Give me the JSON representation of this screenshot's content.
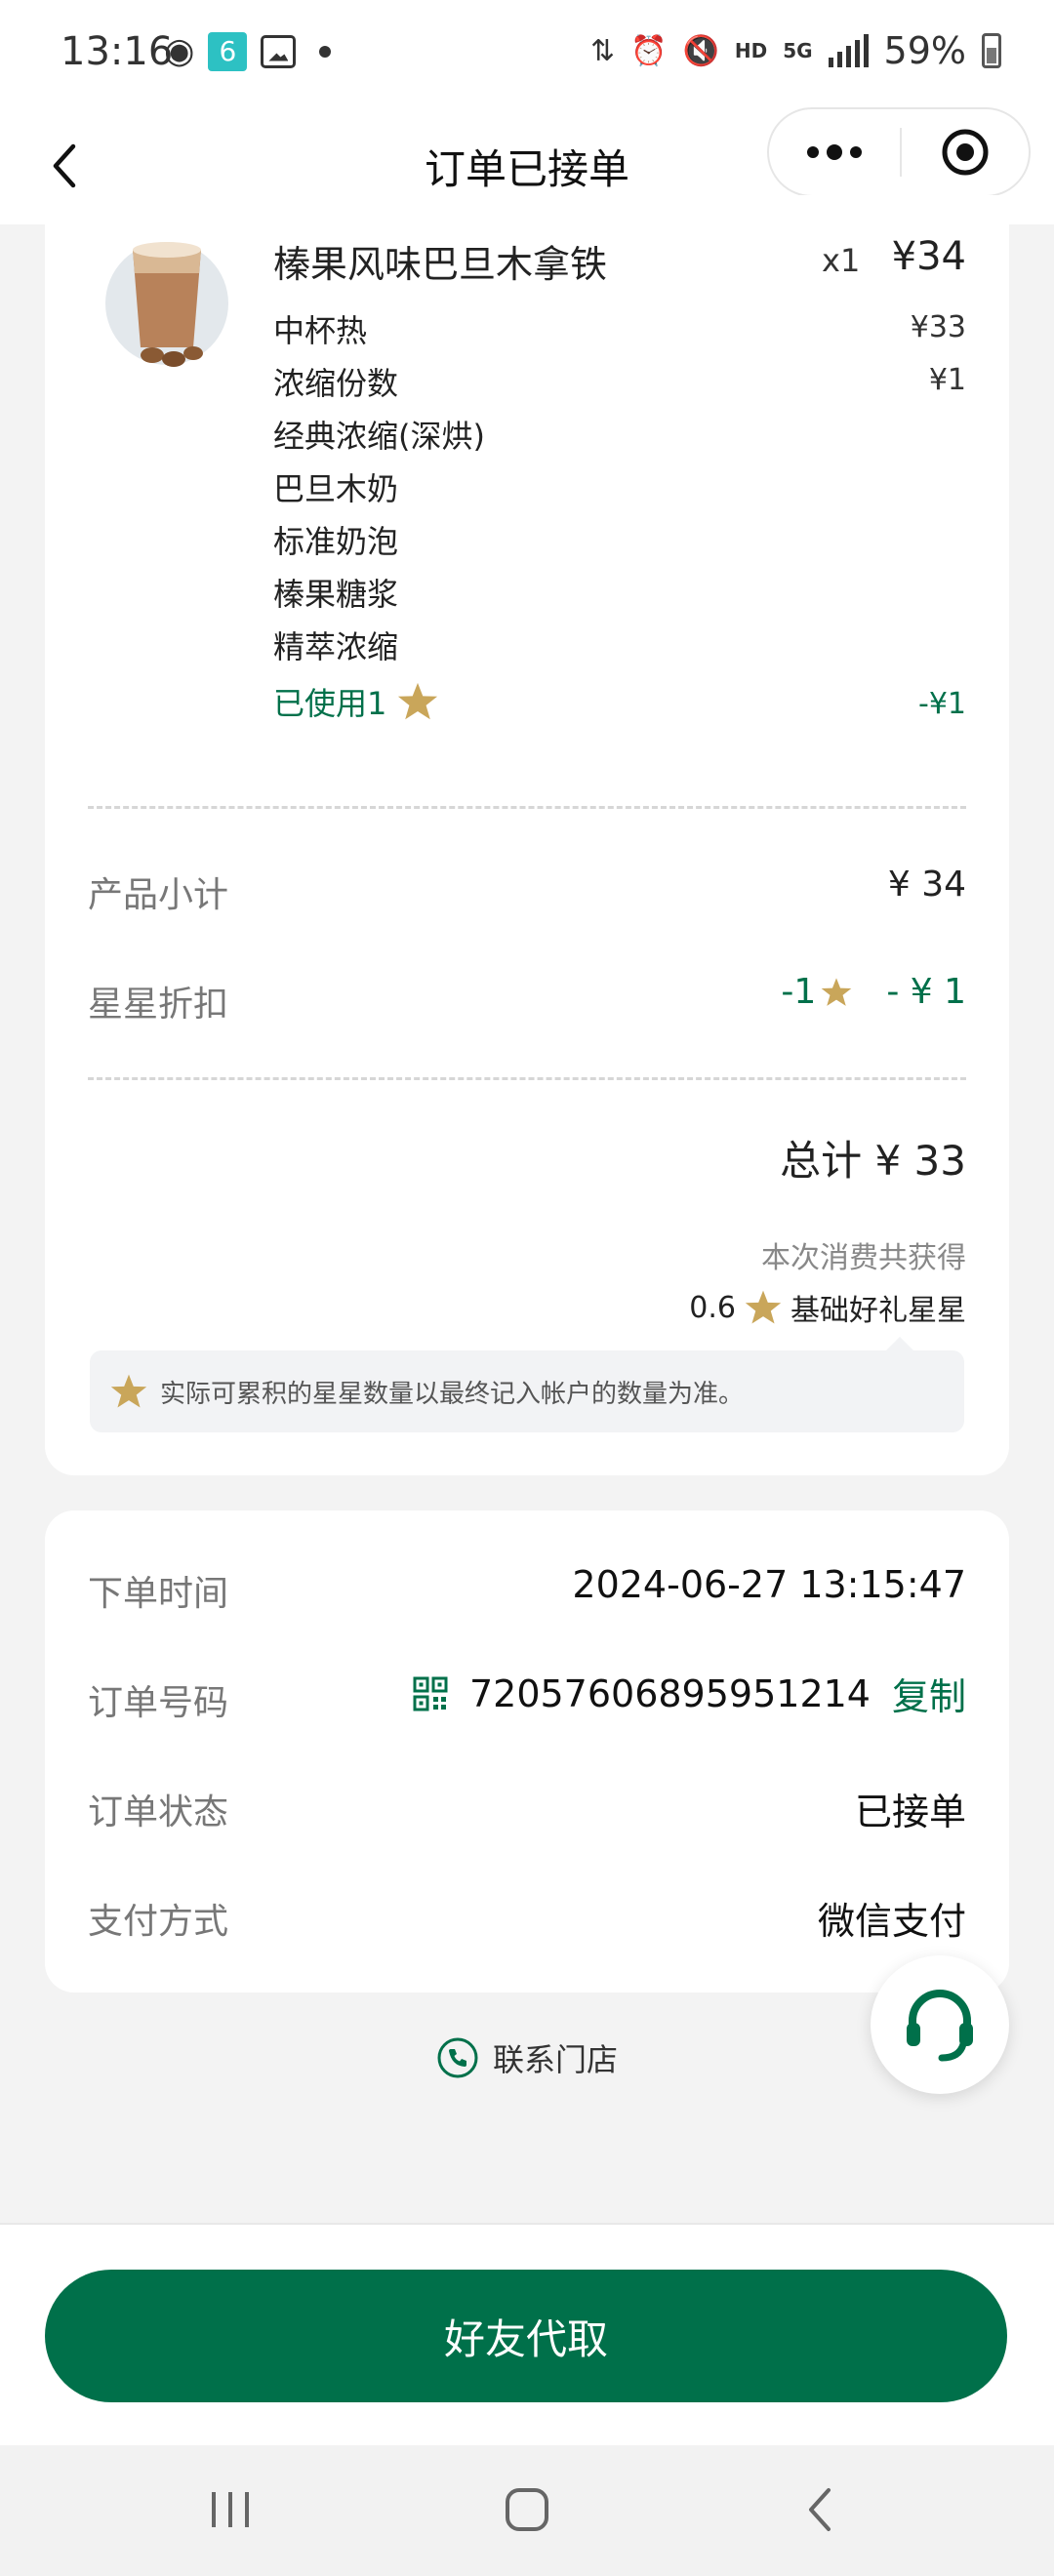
{
  "status_bar": {
    "time": "13:16",
    "badge_number": "6",
    "hd": "HD",
    "network": "5G",
    "battery": "59%"
  },
  "nav": {
    "title": "订单已接单"
  },
  "product": {
    "name": "榛果风味巴旦木拿铁",
    "quantity": "x1",
    "price": "¥34",
    "options": [
      {
        "label": "中杯热",
        "price": "¥33"
      },
      {
        "label": "浓缩份数",
        "price": "¥1"
      },
      {
        "label": "经典浓缩(深烘)",
        "price": ""
      },
      {
        "label": "巴旦木奶",
        "price": ""
      },
      {
        "label": "标准奶泡",
        "price": ""
      },
      {
        "label": "榛果糖浆",
        "price": ""
      },
      {
        "label": "精萃浓缩",
        "price": ""
      }
    ],
    "stars_used_label": "已使用1",
    "stars_used_value": "-¥1"
  },
  "summary": {
    "subtotal_label": "产品小计",
    "subtotal_value": "¥ 34",
    "star_discount_label": "星星折扣",
    "star_discount_stars": "-1",
    "star_discount_value": "- ¥ 1",
    "total": "总计 ¥ 33",
    "earn_title": "本次消费共获得",
    "earn_amount": "0.6",
    "earn_type": "基础好礼星星",
    "notice": "实际可累积的星星数量以最终记入帐户的数量为准。"
  },
  "info": {
    "order_time_label": "下单时间",
    "order_time_value": "2024-06-27 13:15:47",
    "order_no_label": "订单号码",
    "order_no_value": "72057606895951214",
    "copy_label": "复制",
    "order_status_label": "订单状态",
    "order_status_value": "已接单",
    "payment_label": "支付方式",
    "payment_value": "微信支付"
  },
  "contact_store": "联系门店",
  "primary_action": "好友代取",
  "colors": {
    "brand_green": "#00704a",
    "star_gold": "#c9a65a"
  }
}
